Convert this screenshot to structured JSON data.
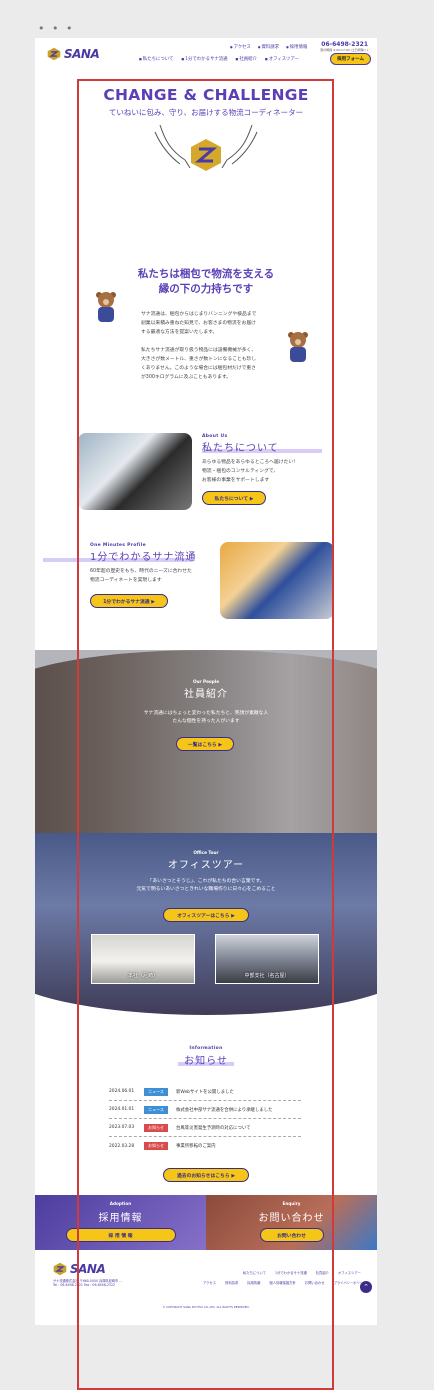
{
  "window": {
    "dots": "• • •"
  },
  "header": {
    "logo_text": "SANA",
    "top_links": [
      "アクセス",
      "資料請求",
      "採用情報"
    ],
    "phone": "06-6498-2321",
    "phone_note": "受付時間 9:00-17:00 (土日祝除く)",
    "nav": [
      "私たちについて",
      "1分でわかるサナ流通",
      "社員紹介",
      "オフィスツアー"
    ],
    "recruit_label": "採用フォーム"
  },
  "hero": {
    "title": "CHANGE & CHALLENGE",
    "subtitle": "ていねいに包み、守り、お届けする物流コーディネーター"
  },
  "intro": {
    "title_line1": "私たちは梱包で物流を支える",
    "title_line2": "縁の下の力持ちです",
    "p1": [
      "サナ流通は、梱包からはじまりバンニングや検品まで",
      "創業以来積み重ねた知見で、お客さまの物流をお届け",
      "する最適な方法を提案いたします。"
    ],
    "p2": [
      "私たちサナ流通が取り扱う物品には設備機械が多く、",
      "大きさが数メートル、重さが数トンになることも珍し",
      "くありません。このような場合には梱包材だけで重さ",
      "が300キログラムに及ぶこともあります。"
    ]
  },
  "about": {
    "eyebrow": "About Us",
    "title": "私たちについて",
    "lines": [
      "あらゆる物品をあらゆるところへ届けたい！",
      "物流・梱包のコンサルティングで、",
      "お客様の事業をサポートします"
    ],
    "button": "私たちについて ▶"
  },
  "profile": {
    "eyebrow": "One Minutes Profile",
    "title": "1分でわかるサナ流通",
    "lines": [
      "60年超の歴史をもち、時代のニーズに合わせた",
      "物流コーディネートを実現します"
    ],
    "button": "1分でわかるサナ流通 ▶"
  },
  "staff": {
    "eyebrow": "Our People",
    "title": "社員紹介",
    "lines": [
      "サナ流通にはちょっと変わった私たちと、笑顔が素敵な人",
      "たんな個性を持った人がいます"
    ],
    "button": "一覧はこちら ▶"
  },
  "tour": {
    "eyebrow": "Office Tour",
    "title": "オフィスツアー",
    "lines": [
      "「あいさつとそうじ」、これが私たちの合い言葉です。",
      "元気で明るいあいさつときれいな職場作りに日々心をこめること"
    ],
    "button": "オフィスツアーはこちら ▶",
    "photo1": "本社（尼崎）",
    "photo2": "中部支社（名古屋）"
  },
  "news": {
    "eyebrow": "Information",
    "title": "お知らせ",
    "button": "過去のお知らせはこちら ▶",
    "items": [
      {
        "date": "2024.06.01",
        "tag": "ニュース",
        "color": "#3f8fd6",
        "text": "新Webサイトを公開しました"
      },
      {
        "date": "2024.01.01",
        "tag": "ニュース",
        "color": "#3f8fd6",
        "text": "株式会社中部サナ流通を合併により承継しました"
      },
      {
        "date": "2023.07.03",
        "tag": "お知らせ",
        "color": "#d84b4b",
        "text": "台風等災害発生予測時の対応について"
      },
      {
        "date": "2022.03.28",
        "tag": "お知らせ",
        "color": "#d84b4b",
        "text": "事業所移転のご案内"
      }
    ]
  },
  "banners": {
    "left": {
      "eyebrow": "Adoption",
      "title": "採用情報",
      "button": "採 用 情 報"
    },
    "right": {
      "eyebrow": "Enquiry",
      "title": "お問い合わせ",
      "button": "お問い合わせ"
    }
  },
  "footer": {
    "logo_text": "SANA",
    "address": "サナ流通株式会社 〒660-0000 兵庫県尼崎市 ...",
    "tel": "Tel : 06-6498-2321  Fax : 06-6498-2322",
    "links_row1": [
      "私たちについて",
      "1分でわかるサナ流通",
      "社員紹介",
      "オフィスツアー"
    ],
    "links_row2": [
      "アクセス",
      "資料請求",
      "採用情報",
      "個人情報保護方針",
      "お問い合わせ",
      "プライバシーポリシー"
    ],
    "copyright": "© COPYRIGHT SANA RYUTSU CO.,LTD. ALL RIGHTS RESERVED."
  }
}
